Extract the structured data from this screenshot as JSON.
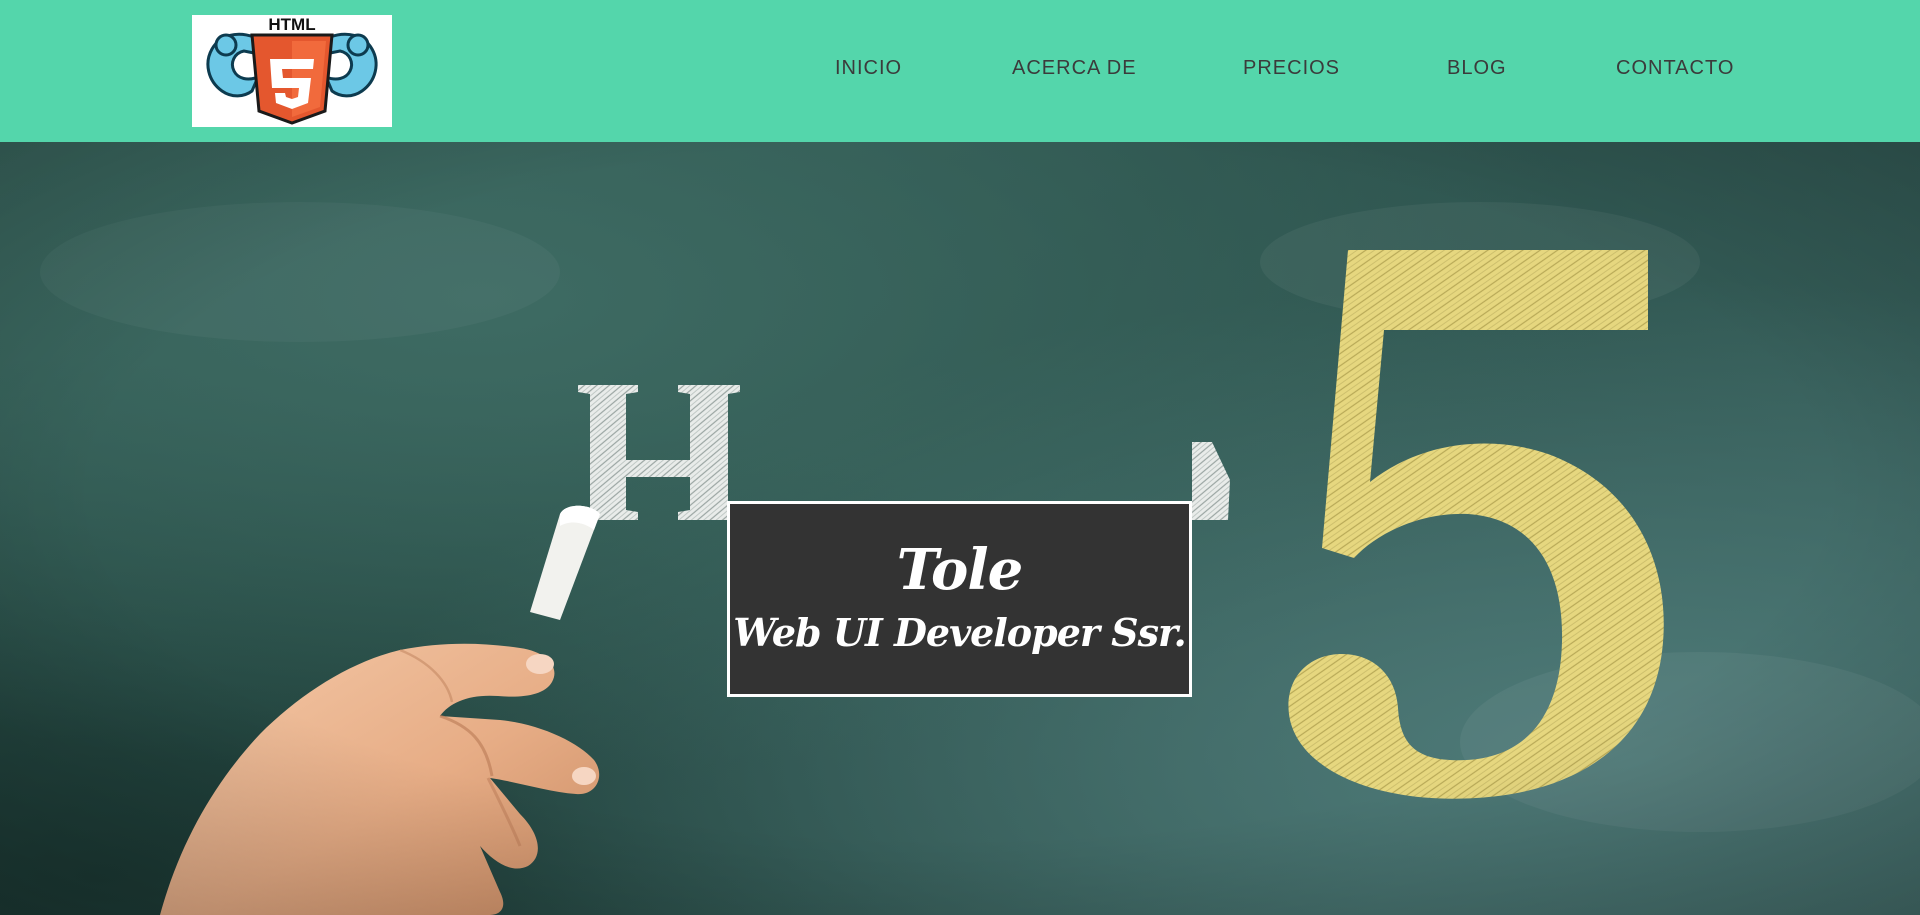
{
  "header": {
    "logo": {
      "text": "HTML",
      "number": "5",
      "icon": "html5-muscle-logo-icon"
    },
    "nav": [
      {
        "label": "INICIO"
      },
      {
        "label": "ACERCA DE"
      },
      {
        "label": "PRECIOS"
      },
      {
        "label": "BLOG"
      },
      {
        "label": "CONTACTO"
      }
    ]
  },
  "hero": {
    "background_icon": "chalkboard-html5-hand-image",
    "title": {
      "name": "Tole",
      "role": "Web UI Developer Ssr."
    }
  },
  "colors": {
    "header_bg": "#54d6ab",
    "nav_text": "#3b3b3b",
    "card_bg": "#333333",
    "card_border": "#ffffff",
    "chalkboard": "#2f5750",
    "chalk_yellow": "#e3d37a"
  }
}
